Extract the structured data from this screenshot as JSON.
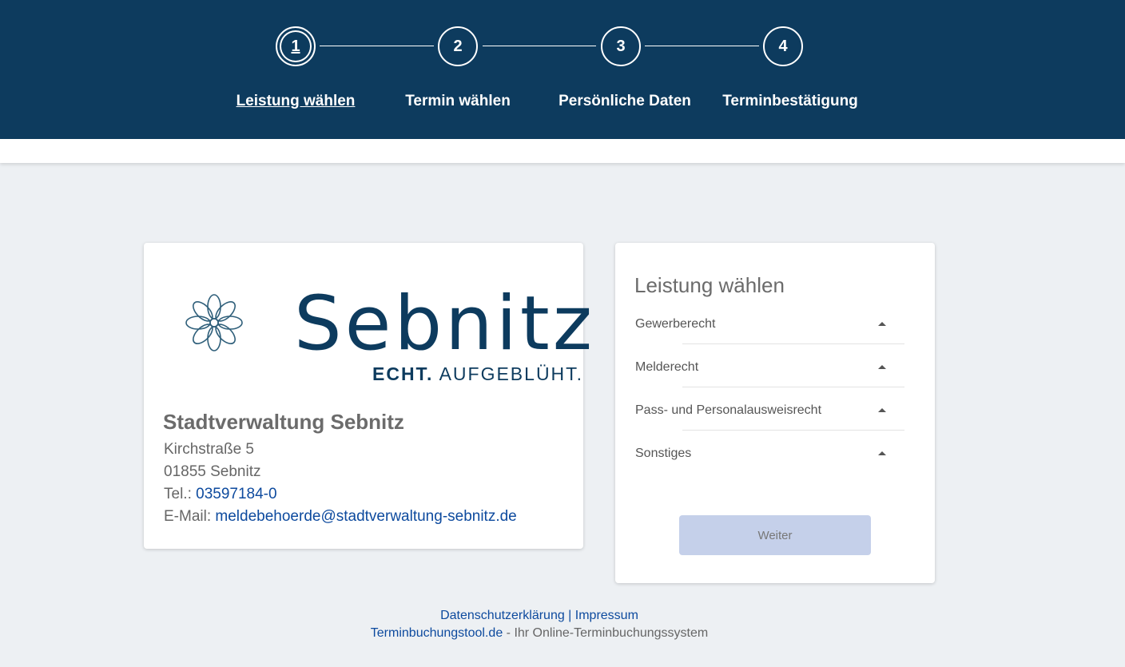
{
  "stepper": {
    "steps": [
      {
        "number": "1",
        "label": "Leistung wählen",
        "active": true
      },
      {
        "number": "2",
        "label": "Termin wählen",
        "active": false
      },
      {
        "number": "3",
        "label": "Persönliche Daten",
        "active": false
      },
      {
        "number": "4",
        "label": "Terminbestätigung",
        "active": false
      }
    ]
  },
  "logo": {
    "wordmark": "Sebnitz",
    "tagline_bold": "ECHT.",
    "tagline_rest": "AUFGEBLÜHT."
  },
  "office": {
    "name": "Stadtverwaltung Sebnitz",
    "street": "Kirchstraße 5",
    "city": "01855 Sebnitz",
    "phone_label": "Tel.: ",
    "phone": "03597184-0",
    "email_label": "E-Mail: ",
    "email": "meldebehoerde@stadtverwaltung-sebnitz.de"
  },
  "services": {
    "title": "Leistung wählen",
    "items": [
      {
        "label": "Gewerberecht"
      },
      {
        "label": "Melderecht"
      },
      {
        "label": "Pass- und Personalausweisrecht"
      },
      {
        "label": "Sonstiges"
      }
    ],
    "next_button": "Weiter"
  },
  "footer": {
    "privacy": "Datenschutzerklärung",
    "separator": " | ",
    "imprint": "Impressum",
    "tool_link": "Terminbuchungstool.de",
    "tool_suffix": " - Ihr Online-Terminbuchungssystem"
  },
  "colors": {
    "header_bg": "#0d3b5e",
    "link": "#0d4a9e",
    "button_disabled": "#c5d0ea",
    "page_bg": "#edf0f3"
  }
}
